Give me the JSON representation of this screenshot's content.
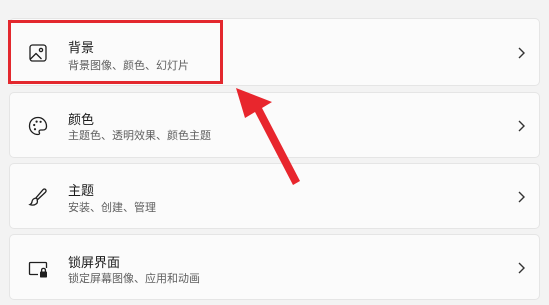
{
  "settings": [
    {
      "title": "背景",
      "subtitle": "背景图像、颜色、幻灯片",
      "icon": "image-icon"
    },
    {
      "title": "颜色",
      "subtitle": "主题色、透明效果、颜色主题",
      "icon": "palette-icon"
    },
    {
      "title": "主题",
      "subtitle": "安装、创建、管理",
      "icon": "brush-icon"
    },
    {
      "title": "锁屏界面",
      "subtitle": "锁定屏幕图像、应用和动画",
      "icon": "lock-screen-icon"
    }
  ],
  "colors": {
    "highlight": "#e3282e",
    "arrow": "#e8262d"
  }
}
